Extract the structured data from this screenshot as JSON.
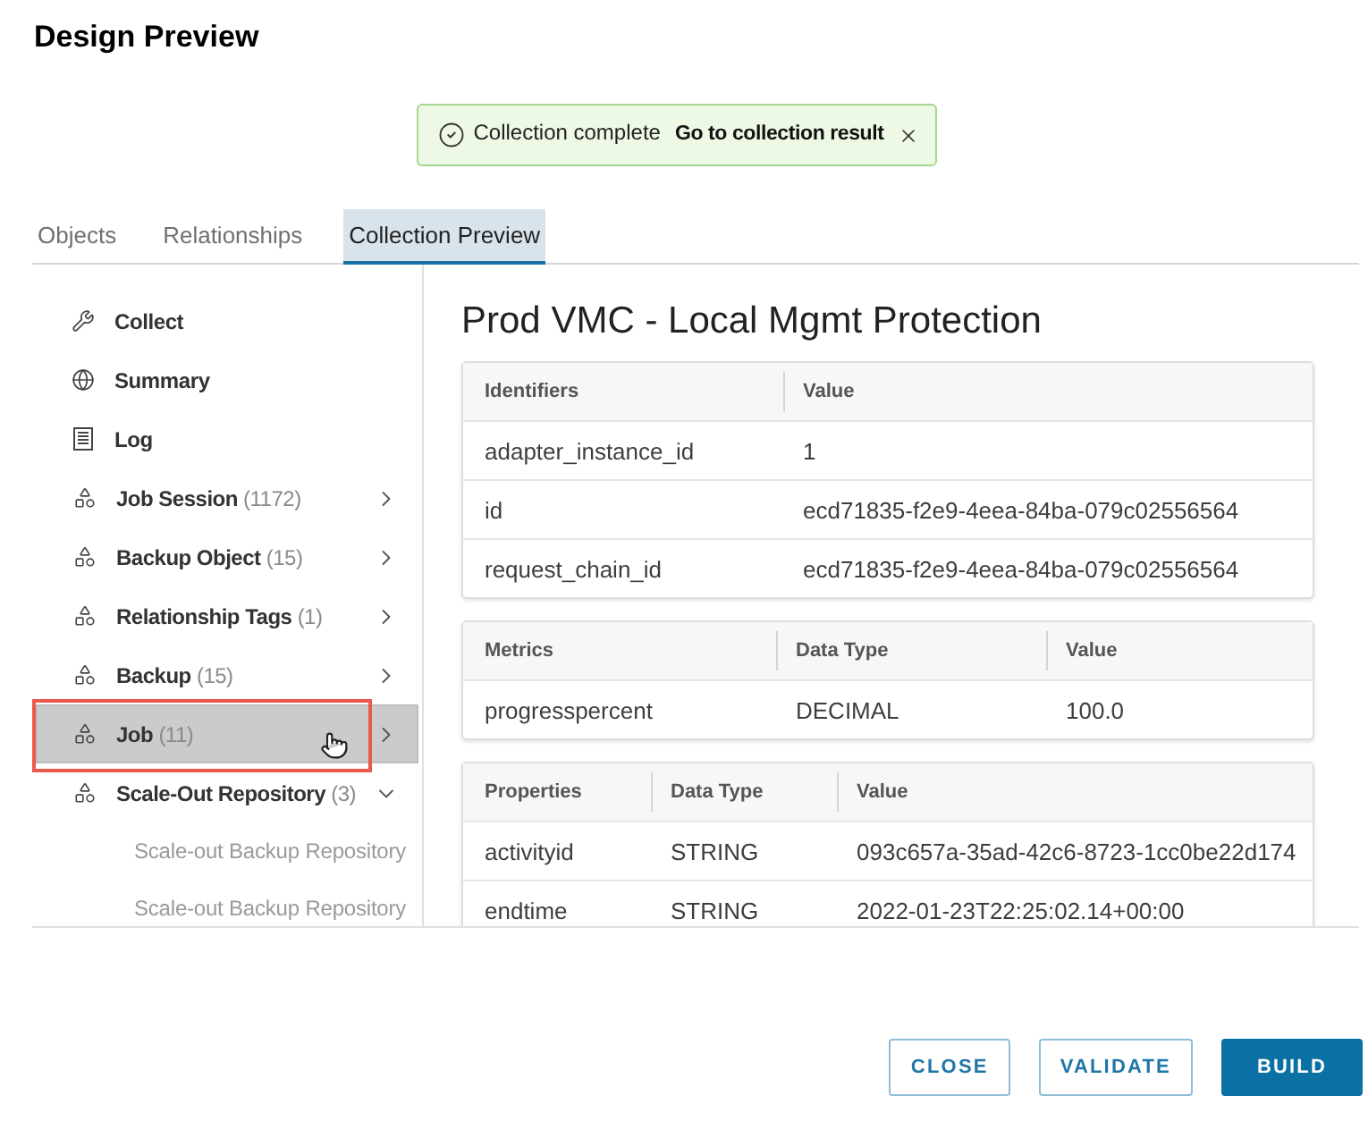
{
  "dialog": {
    "title": "Design Preview"
  },
  "toast": {
    "message": "Collection complete",
    "link": "Go to collection result"
  },
  "tabs": [
    {
      "label": "Objects",
      "selected": false
    },
    {
      "label": "Relationships",
      "selected": false
    },
    {
      "label": "Collection Preview",
      "selected": true
    }
  ],
  "sidebar": {
    "actions": [
      {
        "label": "Collect",
        "selected": false
      },
      {
        "label": "Summary",
        "selected": false
      },
      {
        "label": "Log",
        "selected": false
      }
    ],
    "objects": [
      {
        "label": "Job Session",
        "count": "(1172)",
        "expanded": false,
        "selected": false
      },
      {
        "label": "Backup Object",
        "count": "(15)",
        "expanded": false,
        "selected": false
      },
      {
        "label": "Relationship Tags",
        "count": "(1)",
        "expanded": false,
        "selected": false
      },
      {
        "label": "Backup",
        "count": "(15)",
        "expanded": false,
        "selected": false
      },
      {
        "label": "Job",
        "count": "(11)",
        "expanded": false,
        "selected": true
      },
      {
        "label": "Scale-Out Repository",
        "count": "(3)",
        "expanded": true,
        "selected": false,
        "children": [
          {
            "label": "Scale-out Backup Repository",
            "selected": false
          },
          {
            "label": "Scale-out Backup Repository",
            "selected": false
          }
        ]
      }
    ]
  },
  "detail": {
    "title": "Prod VMC - Local Mgmt Protection",
    "tables": [
      {
        "columns": [
          "Identifiers",
          "Value"
        ],
        "rows": [
          [
            "adapter_instance_id",
            "1"
          ],
          [
            "id",
            "ecd71835-f2e9-4eea-84ba-079c02556564"
          ],
          [
            "request_chain_id",
            "ecd71835-f2e9-4eea-84ba-079c02556564"
          ]
        ]
      },
      {
        "columns": [
          "Metrics",
          "Data Type",
          "Value"
        ],
        "rows": [
          [
            "progresspercent",
            "DECIMAL",
            "100.0"
          ]
        ]
      },
      {
        "columns": [
          "Properties",
          "Data Type",
          "Value"
        ],
        "rows": [
          [
            "activityid",
            "STRING",
            "093c657a-35ad-42c6-8723-1cc0be22d174"
          ],
          [
            "endtime",
            "STRING",
            "2022-01-23T22:25:02.14+00:00"
          ]
        ]
      }
    ]
  },
  "buttons": [
    {
      "label": "CLOSE",
      "kind": "outline"
    },
    {
      "label": "VALIDATE",
      "kind": "outline"
    },
    {
      "label": "BUILD",
      "kind": "primary"
    }
  ]
}
